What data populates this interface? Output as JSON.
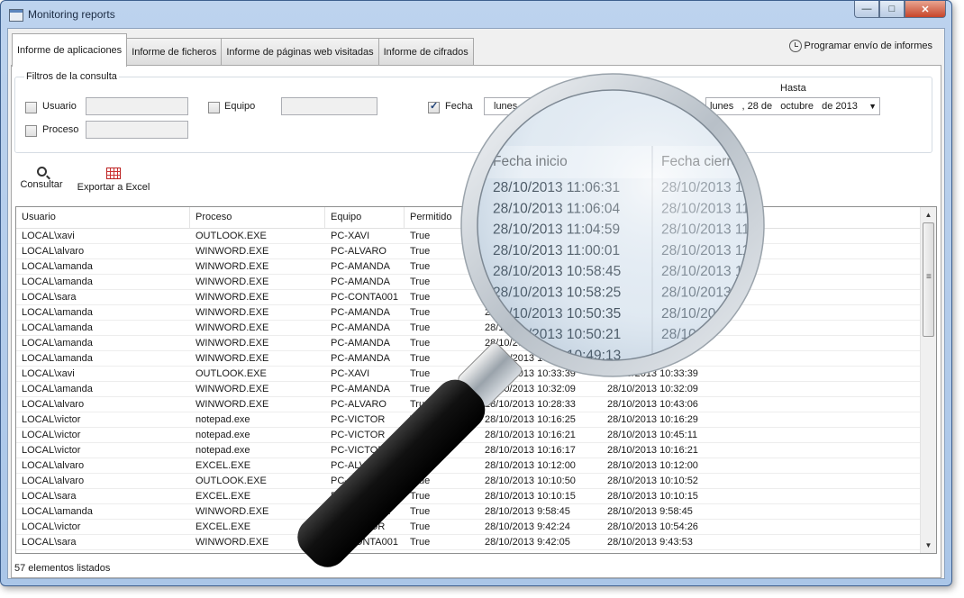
{
  "window": {
    "title": "Monitoring reports",
    "minimize": "—",
    "maximize": "□",
    "close": "✕"
  },
  "tabs": [
    "Informe de aplicaciones",
    "Informe de ficheros",
    "Informe de páginas web visitadas",
    "Informe de cifrados"
  ],
  "active_tab": 0,
  "schedule_label": "Programar envío de informes",
  "filters": {
    "title": "Filtros de la consulta",
    "usuario_label": "Usuario",
    "equipo_label": "Equipo",
    "proceso_label": "Proceso",
    "fecha_label": "Fecha",
    "fecha_checked": true,
    "desde_value": "lunes",
    "hasta_label": "Hasta",
    "hasta_value": "lunes   , 28 de   octubre   de 2013"
  },
  "toolbar": {
    "consultar": "Consultar",
    "exportar": "Exportar a Excel"
  },
  "grid": {
    "columns": [
      "Usuario",
      "Proceso",
      "Equipo",
      "Permitido",
      "Fecha inicio",
      "Fecha cierre"
    ],
    "rows": [
      [
        "LOCAL\\xavi",
        "OUTLOOK.EXE",
        "PC-XAVI",
        "True",
        "28/10/2013 11:06:31",
        "28/10/2013 11"
      ],
      [
        "LOCAL\\alvaro",
        "WINWORD.EXE",
        "PC-ALVARO",
        "True",
        "28/10/2013 11:06:04",
        "28/10/2013 11"
      ],
      [
        "LOCAL\\amanda",
        "WINWORD.EXE",
        "PC-AMANDA",
        "True",
        "28/10/2013 11:04:59",
        "28/10/2013 11"
      ],
      [
        "LOCAL\\amanda",
        "WINWORD.EXE",
        "PC-AMANDA",
        "True",
        "28/10/2013 11:00:01",
        "28/10/2013 11"
      ],
      [
        "LOCAL\\sara",
        "WINWORD.EXE",
        "PC-CONTA001",
        "True",
        "28/10/2013 10:58:45",
        "28/10/2013 1"
      ],
      [
        "LOCAL\\amanda",
        "WINWORD.EXE",
        "PC-AMANDA",
        "True",
        "28/10/2013 10:58:25",
        "28/10/2013"
      ],
      [
        "LOCAL\\amanda",
        "WINWORD.EXE",
        "PC-AMANDA",
        "True",
        "28/10/2013 10:50:35",
        "28/10/20"
      ],
      [
        "LOCAL\\amanda",
        "WINWORD.EXE",
        "PC-AMANDA",
        "True",
        "28/10/2013 10:50:21",
        "28/10"
      ],
      [
        "LOCAL\\amanda",
        "WINWORD.EXE",
        "PC-AMANDA",
        "True",
        "28/10/2013 10:49:13",
        ""
      ],
      [
        "LOCAL\\xavi",
        "OUTLOOK.EXE",
        "PC-XAVI",
        "True",
        "28/10/2013 10:33:39",
        "28/10/2013 10:33:39"
      ],
      [
        "LOCAL\\amanda",
        "WINWORD.EXE",
        "PC-AMANDA",
        "True",
        "28/10/2013 10:32:09",
        "28/10/2013 10:32:09"
      ],
      [
        "LOCAL\\alvaro",
        "WINWORD.EXE",
        "PC-ALVARO",
        "True",
        "28/10/2013 10:28:33",
        "28/10/2013 10:43:06"
      ],
      [
        "LOCAL\\victor",
        "notepad.exe",
        "PC-VICTOR",
        "True",
        "28/10/2013 10:16:25",
        "28/10/2013 10:16:29"
      ],
      [
        "LOCAL\\victor",
        "notepad.exe",
        "PC-VICTOR",
        "True",
        "28/10/2013 10:16:21",
        "28/10/2013 10:45:11"
      ],
      [
        "LOCAL\\victor",
        "notepad.exe",
        "PC-VICTOR",
        "True",
        "28/10/2013 10:16:17",
        "28/10/2013 10:16:21"
      ],
      [
        "LOCAL\\alvaro",
        "EXCEL.EXE",
        "PC-ALVARO",
        "True",
        "28/10/2013 10:12:00",
        "28/10/2013 10:12:00"
      ],
      [
        "LOCAL\\alvaro",
        "OUTLOOK.EXE",
        "PC-ALVARO",
        "True",
        "28/10/2013 10:10:50",
        "28/10/2013 10:10:52"
      ],
      [
        "LOCAL\\sara",
        "EXCEL.EXE",
        "PC-CONTA001",
        "True",
        "28/10/2013 10:10:15",
        "28/10/2013 10:10:15"
      ],
      [
        "LOCAL\\amanda",
        "WINWORD.EXE",
        "PC-AMANDA",
        "True",
        "28/10/2013 9:58:45",
        "28/10/2013 9:58:45"
      ],
      [
        "LOCAL\\victor",
        "EXCEL.EXE",
        "PC-VICTOR",
        "True",
        "28/10/2013 9:42:24",
        "28/10/2013 10:54:26"
      ],
      [
        "LOCAL\\sara",
        "WINWORD.EXE",
        "PC-CONTA001",
        "True",
        "28/10/2013 9:42:05",
        "28/10/2013 9:43:53"
      ]
    ]
  },
  "status_text": "57 elementos listados",
  "magnifier": {
    "header": [
      "Fecha inicio",
      "Fecha cierre"
    ],
    "rows": [
      [
        "28/10/2013 11:06:31",
        "28/10/2013 11"
      ],
      [
        "28/10/2013 11:06:04",
        "28/10/2013 11"
      ],
      [
        "28/10/2013 11:04:59",
        "28/10/2013 11"
      ],
      [
        "28/10/2013 11:00:01",
        "28/10/2013 11"
      ],
      [
        "28/10/2013 10:58:45",
        "28/10/2013 1"
      ],
      [
        "28/10/2013 10:58:25",
        "28/10/2013"
      ],
      [
        "28/10/2013 10:50:35",
        "28/10/20"
      ],
      [
        "28/10/2013 10:50:21",
        "28/10"
      ],
      [
        "28/10/2013 10:49:13",
        ""
      ]
    ]
  },
  "colors": {
    "accent": "#3d5f8e",
    "grid_border": "#8e8f8f",
    "lens_tint": "#c7dcef"
  }
}
